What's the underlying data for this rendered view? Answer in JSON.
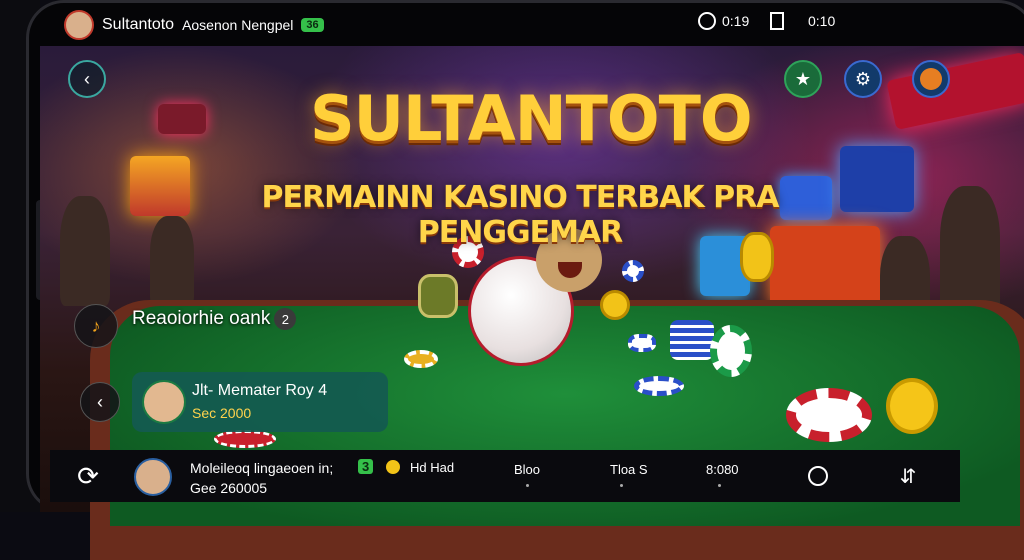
{
  "status_bar": {
    "username": "Sultantoto",
    "app_subtitle": "Aosenon Nengpel",
    "badge": "36",
    "right_1": "0:19",
    "right_2": "0:10"
  },
  "hero": {
    "title": "SULTANTOTO",
    "subtitle": "PERMAINN KASINO TERBAK PRA PENGGEMAR"
  },
  "replay_prompt": {
    "label": "Reaoiorhie oank",
    "badge": "2"
  },
  "notice": {
    "line1": "Jlt- Memater Roy 4",
    "line2": "Sec 2000"
  },
  "bottom_bar": {
    "user_line1": "Moleileoq lingaeoen in;",
    "user_badge": "3",
    "user_extra": "Hd Had",
    "user_line2": "Gee 260005",
    "tab_1": "Bloo",
    "tab_2": "Tloa S",
    "tab_3": "8:080"
  },
  "icons": {
    "back": "chevron-left-icon",
    "star": "star-icon",
    "settings": "gear-icon",
    "profile": "mascot-avatar-icon",
    "music": "music-note-icon",
    "help": "question-icon",
    "search": "search-icon",
    "menu": "menu-icon"
  },
  "colors": {
    "title": "#ffcf3a",
    "felt": "#1f8f3a",
    "accent_green": "#35c04a",
    "chip_red": "#c8202c"
  }
}
